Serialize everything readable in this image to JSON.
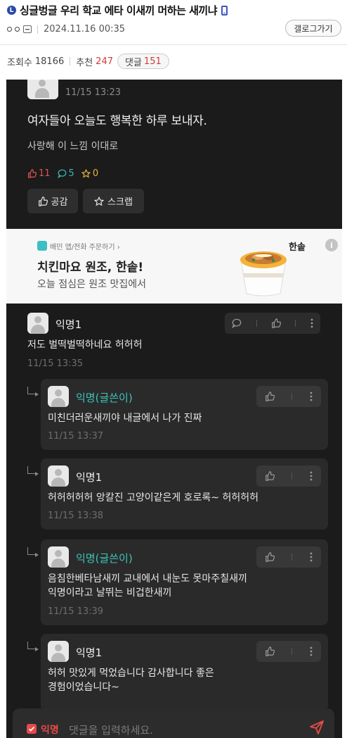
{
  "header": {
    "badge": "L",
    "title": "싱글벙글 우리 학교 에타 이새끼 머하는 새끼냐",
    "date": "2024.11.16 00:35",
    "gallery_button": "갤로그가기"
  },
  "stats": {
    "views_label": "조회수",
    "views": "18166",
    "recommend_label": "추천",
    "recommend": "247",
    "comments_label": "댓글",
    "comments": "151"
  },
  "post": {
    "time": "11/15 13:23",
    "heading": "여자들아 오늘도 행복한 하루 보내자.",
    "body": "사랑해 이 느낌 이대로",
    "likes": "11",
    "comment_count": "5",
    "scraps": "0",
    "like_button": "공감",
    "scrap_button": "스크랩"
  },
  "ad": {
    "source": "배민 앱/전화 주문하기 ›",
    "brand": "한솥",
    "info": "i",
    "title": "치킨마요 원조, 한솥!",
    "desc": "오늘 점심은 원조 맛집에서"
  },
  "comments": [
    {
      "name": "익명1",
      "text": "저도 벌떡벌떡하네요 허허허",
      "time": "11/15 13:35"
    }
  ],
  "replies": [
    {
      "name": "익명(글쓴이)",
      "lines": [
        "미친더러운새끼야 내글에서 나가 진짜"
      ],
      "time": "11/15 13:37"
    },
    {
      "name": "익명1",
      "lines": [
        "허허허허허 앙칼진 고양이같은게 호로록~ 허허허허"
      ],
      "time": "11/15 13:38"
    },
    {
      "name": "익명(글쓴이)",
      "lines": [
        "음침한베타남새끼 교내에서 내눈도 못마주칠새끼",
        "익명이라고 날뛰는 비겁한새끼"
      ],
      "time": "11/15 13:39"
    },
    {
      "name": "익명1",
      "lines": [
        "허허 맛있게 먹었습니다 감사합니다 좋은",
        "경험이었습니다~"
      ],
      "time": ""
    }
  ],
  "input": {
    "anon_label": "익명",
    "placeholder": "댓글을 입력하세요."
  },
  "colors": {
    "accent_red": "#e84a4a",
    "op_teal": "#3cc4b8",
    "dark_bg": "#1b1b1b"
  }
}
